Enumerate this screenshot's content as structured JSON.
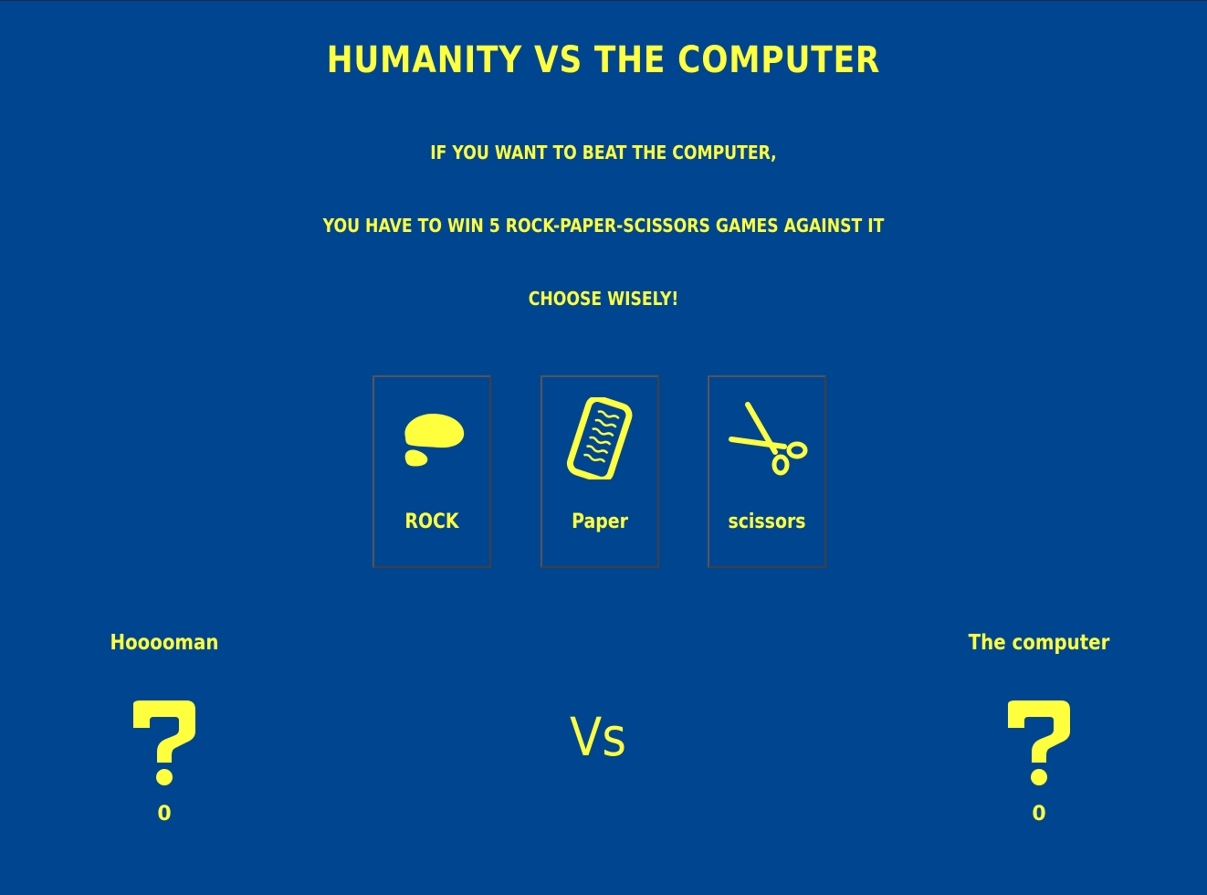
{
  "header": {
    "title": "HUMANITY VS THE COMPUTER",
    "intro_line1": "IF YOU WANT TO BEAT THE COMPUTER,",
    "intro_line2": "YOU HAVE TO WIN 5 ROCK-PAPER-SCISSORS GAMES AGAINST IT",
    "intro_line3": "CHOOSE WISELY!"
  },
  "choices": [
    {
      "label": "ROCK",
      "icon": "rock-icon"
    },
    {
      "label": "Paper",
      "icon": "paper-icon"
    },
    {
      "label": "scissors",
      "icon": "scissors-icon"
    }
  ],
  "players": {
    "human": {
      "name": "Hooooman",
      "score": "0",
      "choice_icon": "question-mark-icon"
    },
    "computer": {
      "name": "The computer",
      "score": "0",
      "choice_icon": "question-mark-icon"
    }
  },
  "vs_label": "Vs",
  "colors": {
    "background": "#004590",
    "accent": "#ffff3d"
  }
}
